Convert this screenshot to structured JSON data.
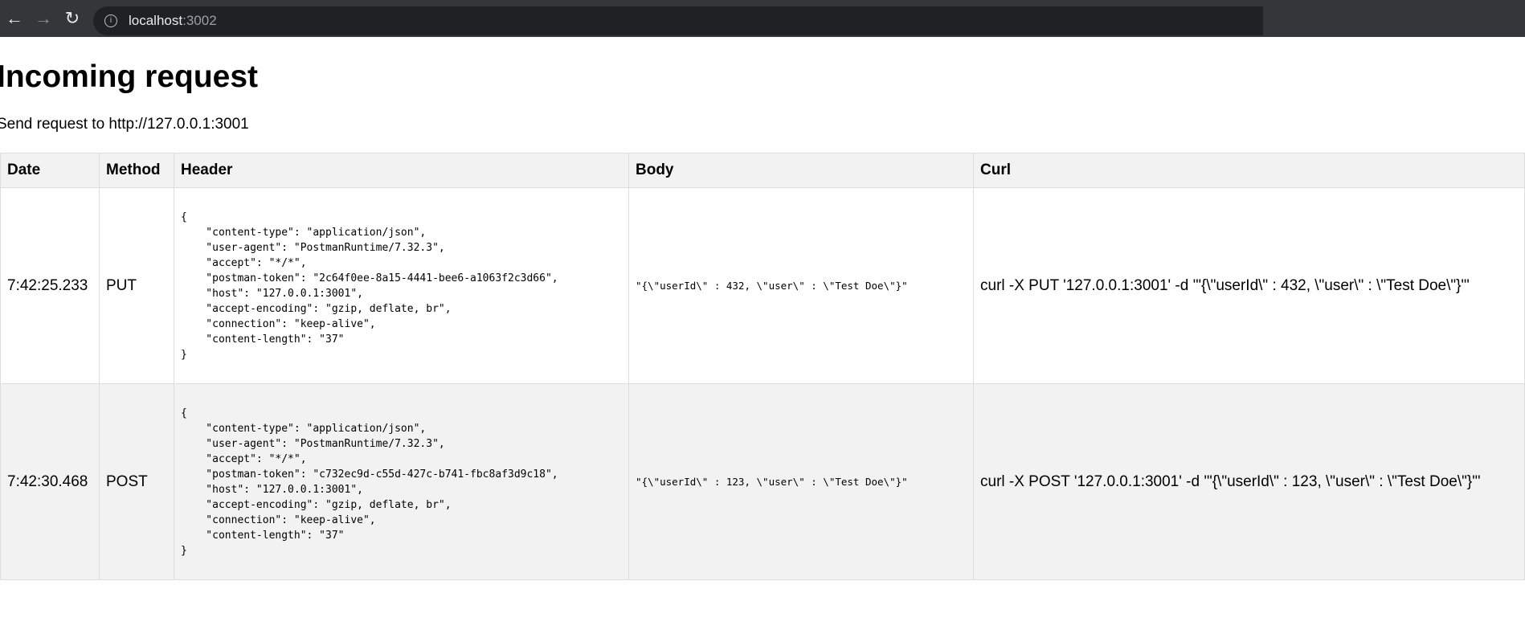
{
  "browser": {
    "url_host": "localhost",
    "url_port": ":3002"
  },
  "page": {
    "title": "Incoming request",
    "subtitle": "Send request to http://127.0.0.1:3001"
  },
  "table": {
    "columns": [
      "Date",
      "Method",
      "Header",
      "Body",
      "Curl"
    ],
    "rows": [
      {
        "date": "7:42:25.233",
        "method": "PUT",
        "header": "{\n    \"content-type\": \"application/json\",\n    \"user-agent\": \"PostmanRuntime/7.32.3\",\n    \"accept\": \"*/*\",\n    \"postman-token\": \"2c64f0ee-8a15-4441-bee6-a1063f2c3d66\",\n    \"host\": \"127.0.0.1:3001\",\n    \"accept-encoding\": \"gzip, deflate, br\",\n    \"connection\": \"keep-alive\",\n    \"content-length\": \"37\"\n}",
        "body": "\"{\\\"userId\\\" : 432, \\\"user\\\" : \\\"Test Doe\\\"}\"",
        "curl": "curl -X PUT '127.0.0.1:3001' -d '\"{\\\"userId\\\" : 432, \\\"user\\\" : \\\"Test Doe\\\"}\"'"
      },
      {
        "date": "7:42:30.468",
        "method": "POST",
        "header": "{\n    \"content-type\": \"application/json\",\n    \"user-agent\": \"PostmanRuntime/7.32.3\",\n    \"accept\": \"*/*\",\n    \"postman-token\": \"c732ec9d-c55d-427c-b741-fbc8af3d9c18\",\n    \"host\": \"127.0.0.1:3001\",\n    \"accept-encoding\": \"gzip, deflate, br\",\n    \"connection\": \"keep-alive\",\n    \"content-length\": \"37\"\n}",
        "body": "\"{\\\"userId\\\" : 123, \\\"user\\\" : \\\"Test Doe\\\"}\"",
        "curl": "curl -X POST '127.0.0.1:3001' -d '\"{\\\"userId\\\" : 123, \\\"user\\\" : \\\"Test Doe\\\"}\"'"
      }
    ]
  }
}
